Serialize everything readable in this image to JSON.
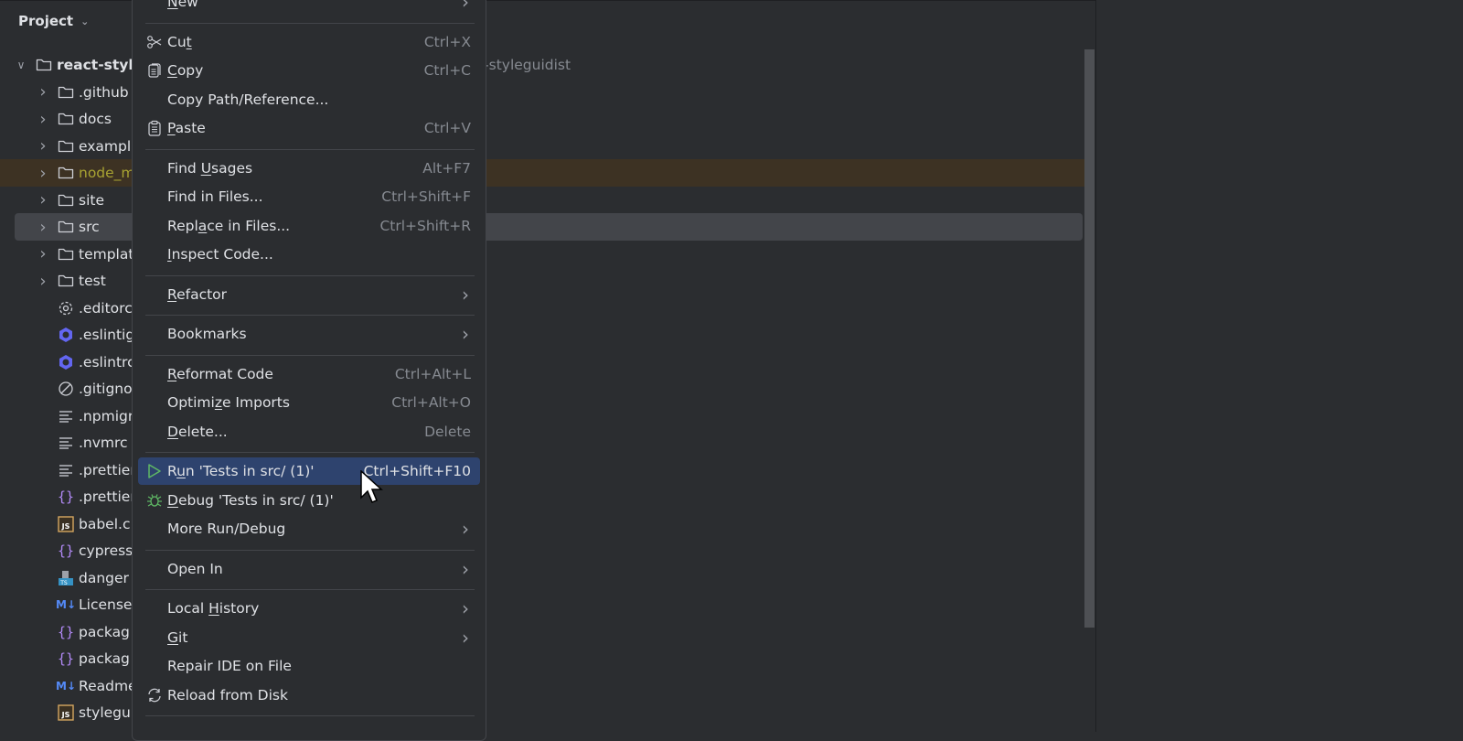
{
  "panel": {
    "title": "Project"
  },
  "path_hint": "ts\\react-styleguidist",
  "tree": [
    {
      "name": "react-styl",
      "type": "folder",
      "expanded": true,
      "root": true
    },
    {
      "name": ".github",
      "type": "folder"
    },
    {
      "name": "docs",
      "type": "folder"
    },
    {
      "name": "exampl",
      "type": "folder"
    },
    {
      "name": "node_m",
      "type": "folder",
      "excluded": true
    },
    {
      "name": "site",
      "type": "folder"
    },
    {
      "name": "src",
      "type": "folder",
      "selected": true
    },
    {
      "name": "templat",
      "type": "folder"
    },
    {
      "name": "test",
      "type": "folder"
    },
    {
      "name": ".editorc",
      "type": "settings"
    },
    {
      "name": ".eslintig",
      "type": "eslint"
    },
    {
      "name": ".eslintrc",
      "type": "eslint"
    },
    {
      "name": ".gitigno",
      "type": "ignore"
    },
    {
      "name": ".npmigr",
      "type": "text"
    },
    {
      "name": ".nvmrc",
      "type": "text"
    },
    {
      "name": ".prettier",
      "type": "text"
    },
    {
      "name": ".prettier",
      "type": "json"
    },
    {
      "name": "babel.c",
      "type": "js"
    },
    {
      "name": "cypress",
      "type": "json"
    },
    {
      "name": "danger",
      "type": "ts"
    },
    {
      "name": "License",
      "type": "md"
    },
    {
      "name": "packag",
      "type": "json"
    },
    {
      "name": "packag",
      "type": "json"
    },
    {
      "name": "Readme",
      "type": "md"
    },
    {
      "name": "stylegu",
      "type": "js"
    }
  ],
  "context_menu": {
    "items": [
      {
        "pre": "",
        "u": "N",
        "post": "ew",
        "shortcut": "",
        "submenu": true,
        "icon": ""
      },
      {
        "sep": true
      },
      {
        "pre": "Cu",
        "u": "t",
        "post": "",
        "shortcut": "Ctrl+X",
        "icon": "scissors"
      },
      {
        "pre": "",
        "u": "C",
        "post": "opy",
        "shortcut": "Ctrl+C",
        "icon": "copy"
      },
      {
        "pre": "Copy Path/Reference...",
        "u": "",
        "post": "",
        "shortcut": "",
        "icon": ""
      },
      {
        "pre": "",
        "u": "P",
        "post": "aste",
        "shortcut": "Ctrl+V",
        "icon": "paste"
      },
      {
        "sep": true
      },
      {
        "pre": "Find ",
        "u": "U",
        "post": "sages",
        "shortcut": "Alt+F7",
        "icon": ""
      },
      {
        "pre": "Find in Files...",
        "u": "",
        "post": "",
        "shortcut": "Ctrl+Shift+F",
        "icon": ""
      },
      {
        "pre": "Repl",
        "u": "a",
        "post": "ce in Files...",
        "shortcut": "Ctrl+Shift+R",
        "icon": ""
      },
      {
        "pre": "",
        "u": "I",
        "post": "nspect Code...",
        "shortcut": "",
        "icon": ""
      },
      {
        "sep": true
      },
      {
        "pre": "",
        "u": "R",
        "post": "efactor",
        "shortcut": "",
        "submenu": true,
        "icon": ""
      },
      {
        "sep": true
      },
      {
        "pre": "Bookmarks",
        "u": "",
        "post": "",
        "shortcut": "",
        "submenu": true,
        "icon": ""
      },
      {
        "sep": true
      },
      {
        "pre": "",
        "u": "R",
        "post": "eformat Code",
        "shortcut": "Ctrl+Alt+L",
        "icon": ""
      },
      {
        "pre": "Optimi",
        "u": "z",
        "post": "e Imports",
        "shortcut": "Ctrl+Alt+O",
        "icon": ""
      },
      {
        "pre": "",
        "u": "D",
        "post": "elete...",
        "shortcut": "Delete",
        "icon": ""
      },
      {
        "sep": true
      },
      {
        "pre": "R",
        "u": "u",
        "post": "n 'Tests in src/ (1)'",
        "shortcut": "Ctrl+Shift+F10",
        "icon": "run",
        "active": true
      },
      {
        "pre": "",
        "u": "D",
        "post": "ebug 'Tests in src/ (1)'",
        "shortcut": "",
        "icon": "debug"
      },
      {
        "pre": "More Run/Debug",
        "u": "",
        "post": "",
        "shortcut": "",
        "submenu": true,
        "icon": ""
      },
      {
        "sep": true
      },
      {
        "pre": "Open In",
        "u": "",
        "post": "",
        "shortcut": "",
        "submenu": true,
        "icon": ""
      },
      {
        "sep": true
      },
      {
        "pre": "Local ",
        "u": "H",
        "post": "istory",
        "shortcut": "",
        "submenu": true,
        "icon": ""
      },
      {
        "pre": "",
        "u": "G",
        "post": "it",
        "shortcut": "",
        "submenu": true,
        "icon": ""
      },
      {
        "pre": "Repair IDE on File",
        "u": "",
        "post": "",
        "shortcut": "",
        "icon": ""
      },
      {
        "pre": "Reload from Disk",
        "u": "",
        "post": "",
        "shortcut": "",
        "icon": "reload"
      },
      {
        "sep": true
      }
    ]
  },
  "colors": {
    "accent_selection": "#2e436e",
    "excluded_folder_text": "#a8a332",
    "excluded_row_bg": "#3d3223",
    "eslint": "#6366f1",
    "json_braces": "#b189f5",
    "markdown": "#548af7",
    "js": "#d4a760",
    "run_green": "#5fb865"
  }
}
